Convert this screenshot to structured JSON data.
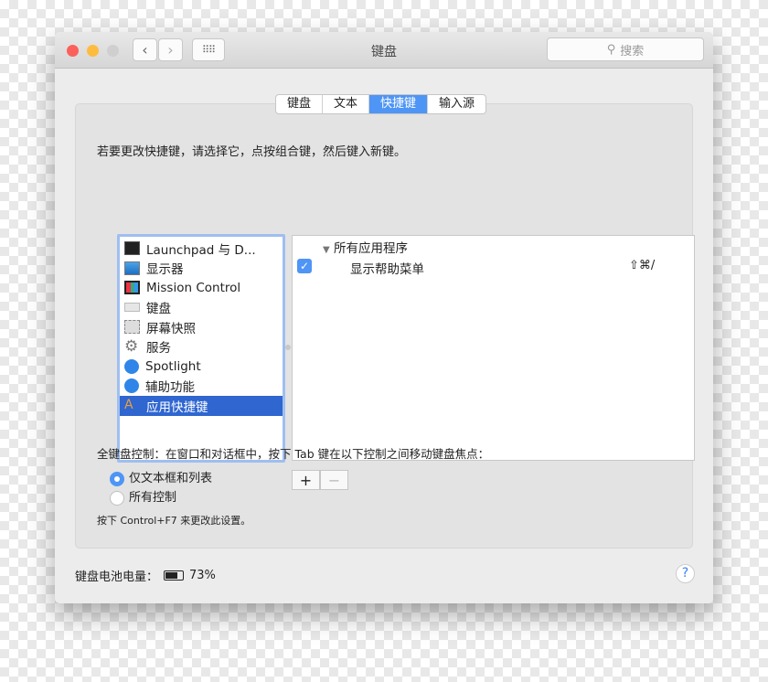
{
  "window": {
    "title": "键盘",
    "search_placeholder": "搜索"
  },
  "tabs": [
    {
      "label": "键盘"
    },
    {
      "label": "文本"
    },
    {
      "label": "快捷键",
      "selected": true
    },
    {
      "label": "输入源"
    }
  ],
  "instruction": "若要更改快捷键，请选择它，点按组合键，然后键入新键。",
  "categories": [
    {
      "label": "Launchpad 与 D...",
      "icon": "launchpad-icon"
    },
    {
      "label": "显示器",
      "icon": "display-icon"
    },
    {
      "label": "Mission Control",
      "icon": "mission-control-icon"
    },
    {
      "label": "键盘",
      "icon": "keyboard-icon"
    },
    {
      "label": "屏幕快照",
      "icon": "screenshot-icon"
    },
    {
      "label": "服务",
      "icon": "gear-icon"
    },
    {
      "label": "Spotlight",
      "icon": "spotlight-icon"
    },
    {
      "label": "辅助功能",
      "icon": "accessibility-icon"
    },
    {
      "label": "应用快捷键",
      "icon": "app-shortcuts-icon",
      "selected": true
    }
  ],
  "shortcuts": {
    "group": "所有应用程序",
    "items": [
      {
        "label": "显示帮助菜单",
        "checked": true,
        "keys": "⇧⌘/"
      }
    ]
  },
  "buttons": {
    "add": "+",
    "remove": "−"
  },
  "full_keyboard": {
    "label": "全键盘控制：在窗口和对话框中，按下 Tab 键在以下控制之间移动键盘焦点：",
    "options": [
      {
        "label": "仅文本框和列表",
        "selected": true
      },
      {
        "label": "所有控制",
        "selected": false
      }
    ],
    "hint": "按下 Control+F7 来更改此设置。"
  },
  "battery": {
    "label": "键盘电池电量：",
    "value": "73%",
    "level": 73
  },
  "help": "?",
  "colors": {
    "accent": "#4e95f5",
    "selection": "#2f66d0"
  }
}
